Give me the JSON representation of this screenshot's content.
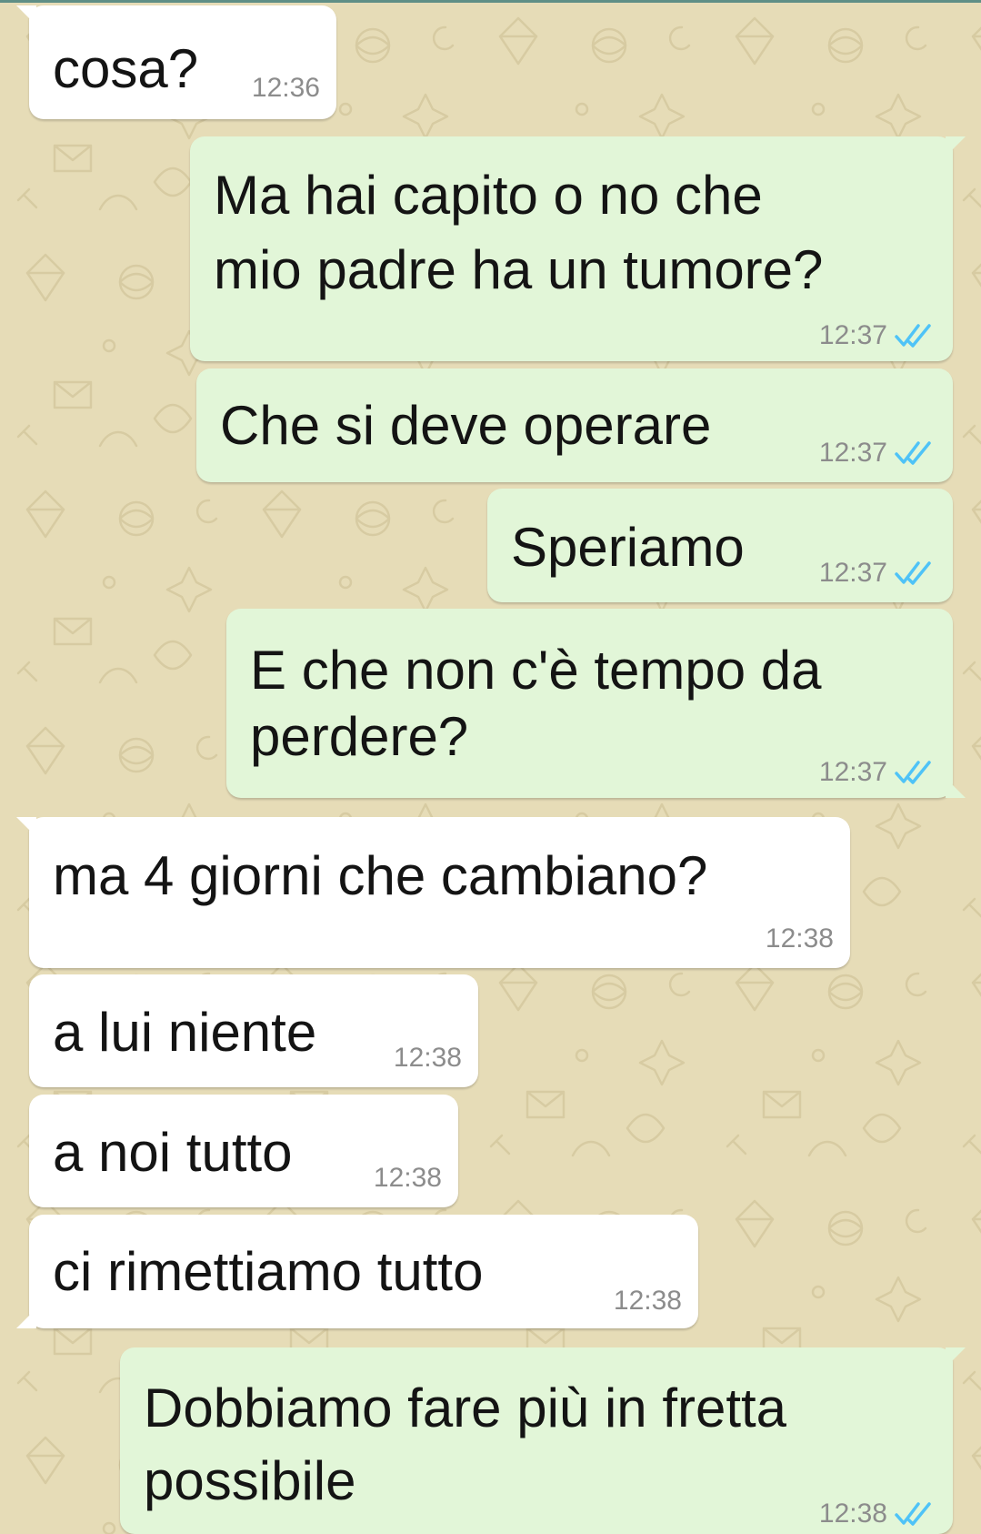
{
  "colors": {
    "wallpaper": "#e6dcb7",
    "incoming_bubble": "#ffffff",
    "outgoing_bubble": "#e2f6d8",
    "read_ticks": "#4fc3f7",
    "timestamp": "#8c8c8c"
  },
  "messages": [
    {
      "direction": "incoming",
      "text_lines": [
        "cosa?"
      ],
      "time": "12:36"
    },
    {
      "direction": "outgoing",
      "text_lines": [
        "Ma hai capito o no che",
        "mio padre ha un tumore?"
      ],
      "time": "12:37",
      "status_icon": "double-check-icon"
    },
    {
      "direction": "outgoing",
      "text_lines": [
        "Che si deve operare"
      ],
      "time": "12:37",
      "status_icon": "double-check-icon"
    },
    {
      "direction": "outgoing",
      "text_lines": [
        "Speriamo"
      ],
      "time": "12:37",
      "status_icon": "double-check-icon"
    },
    {
      "direction": "outgoing",
      "text_lines": [
        "E che non c'è tempo da",
        "perdere?"
      ],
      "time": "12:37",
      "status_icon": "double-check-icon"
    },
    {
      "direction": "incoming",
      "text_lines": [
        "ma 4 giorni che cambiano?"
      ],
      "time": "12:38"
    },
    {
      "direction": "incoming",
      "text_lines": [
        "a lui niente"
      ],
      "time": "12:38"
    },
    {
      "direction": "incoming",
      "text_lines": [
        "a noi tutto"
      ],
      "time": "12:38"
    },
    {
      "direction": "incoming",
      "text_lines": [
        "ci rimettiamo tutto"
      ],
      "time": "12:38"
    },
    {
      "direction": "outgoing",
      "text_lines": [
        "Dobbiamo fare più in fretta",
        "possibile"
      ],
      "time": "12:38",
      "status_icon": "double-check-icon"
    }
  ]
}
